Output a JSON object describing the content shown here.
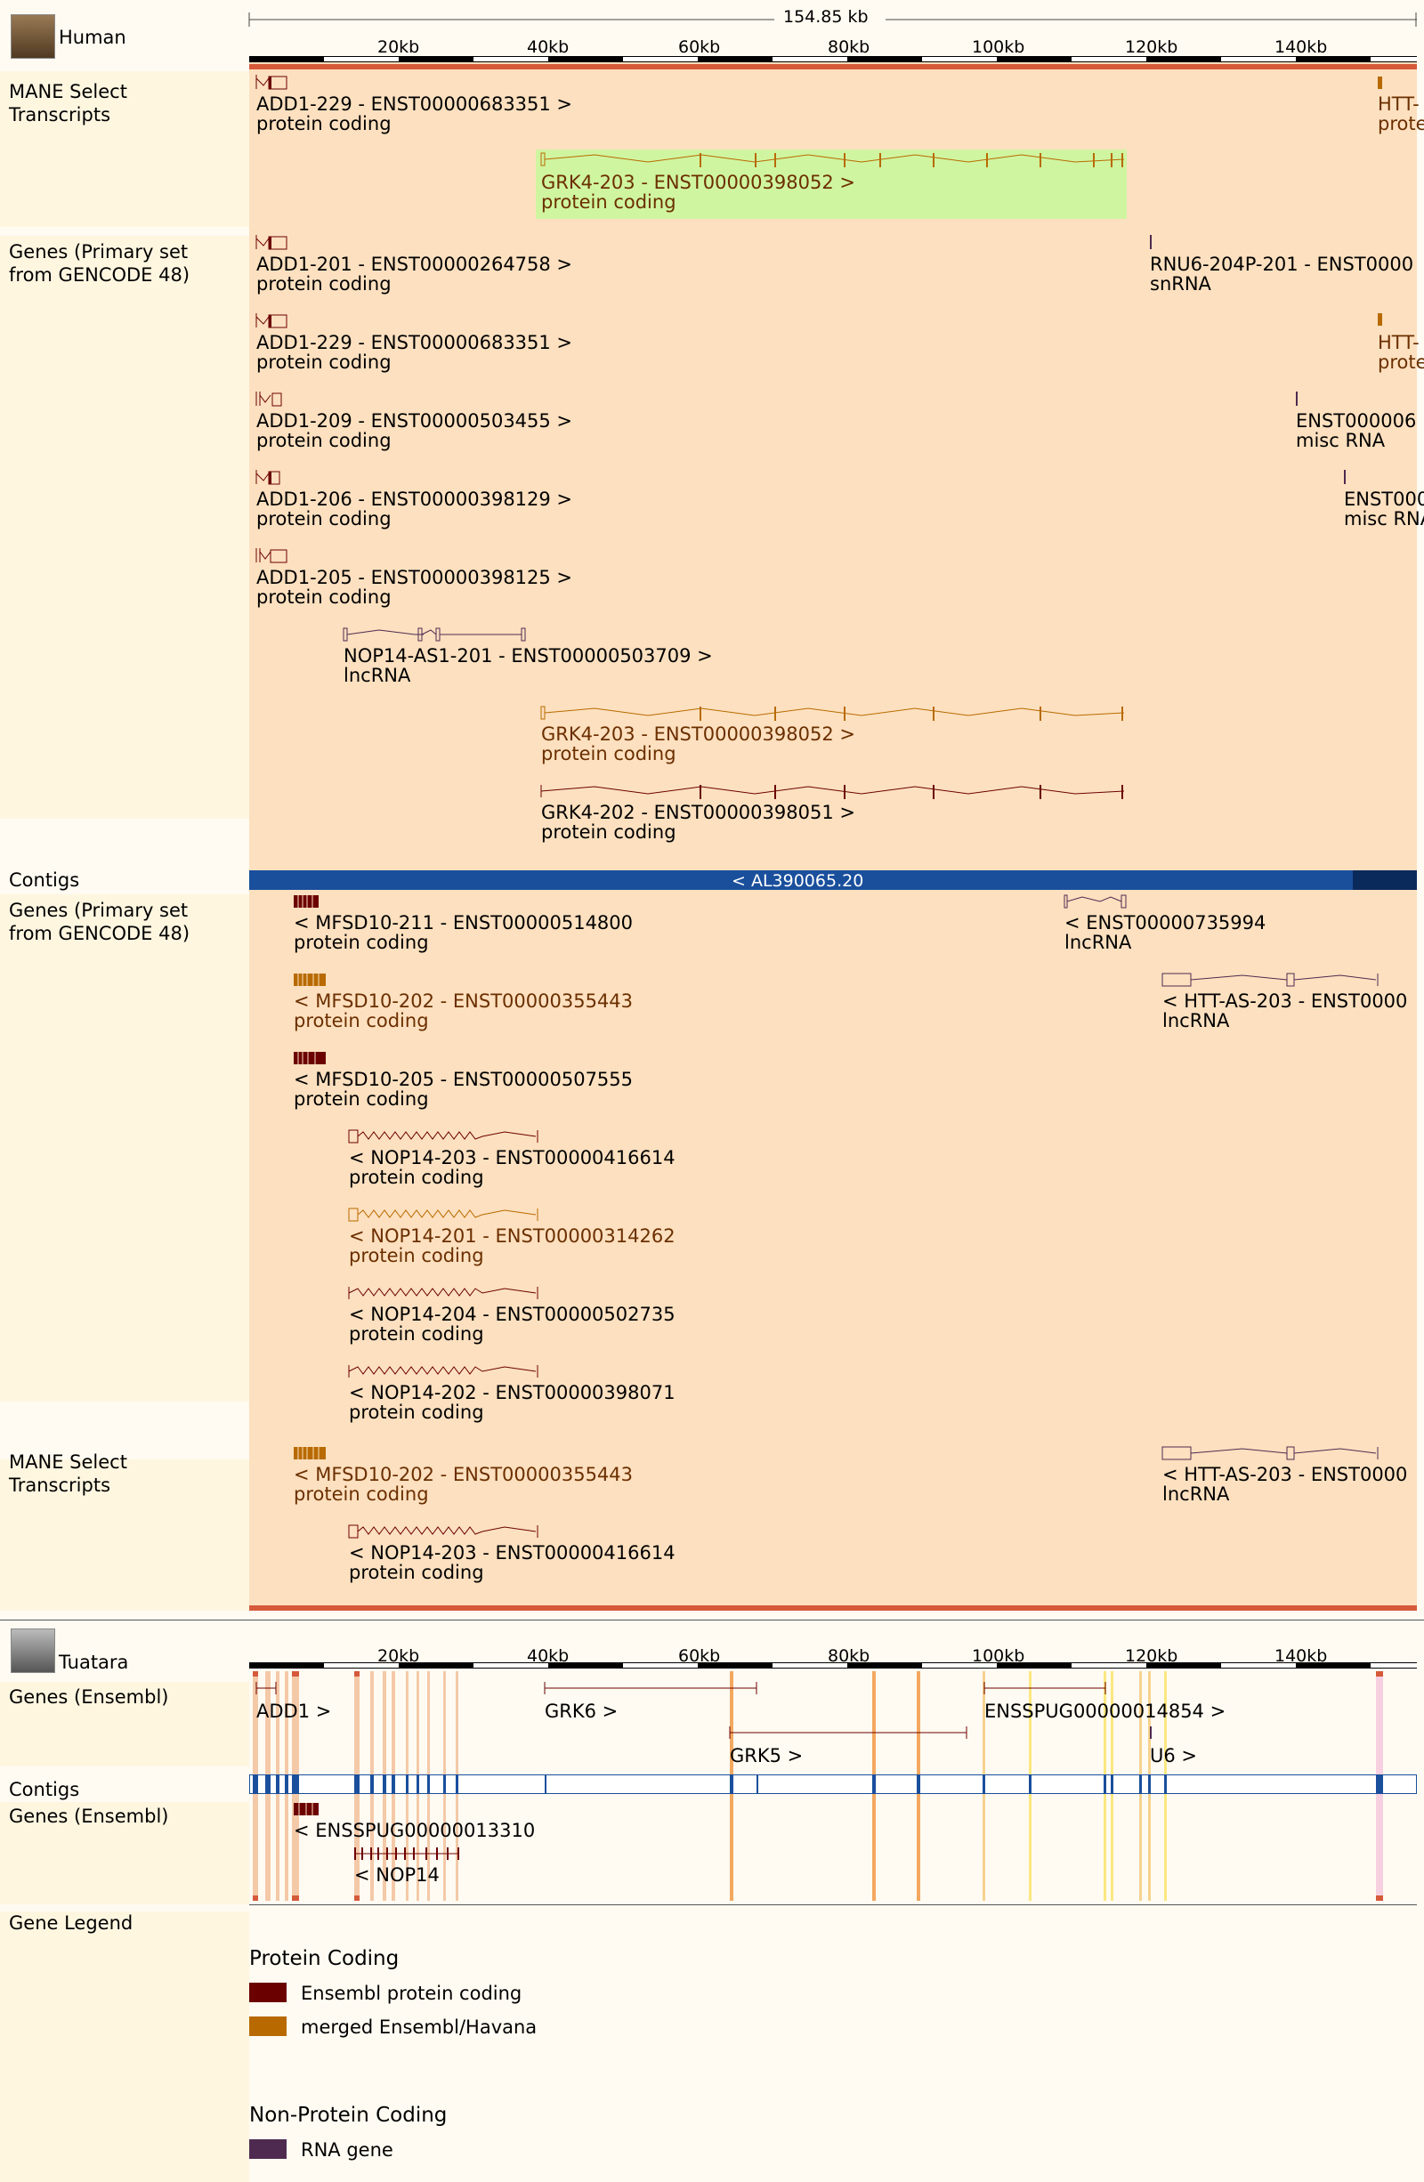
{
  "human": {
    "species": "Human",
    "scale_label": "154.85 kb",
    "ruler_ticks": [
      "20kb",
      "40kb",
      "60kb",
      "80kb",
      "100kb",
      "120kb",
      "140kb"
    ],
    "tracks": {
      "mane1": "MANE Select Transcripts",
      "genes1": "Genes (Primary set from GENCODE 48)",
      "contigs": "Contigs",
      "genes2": "Genes (Primary set from GENCODE 48)",
      "mane2": "MANE Select Transcripts"
    },
    "mane1_features": [
      {
        "id": "ADD1-229 - ENST00000683351 >",
        "type": "protein coding"
      },
      {
        "id": "HTT-",
        "type": "prote"
      },
      {
        "id": "GRK4-203 - ENST00000398052 >",
        "type": "protein coding"
      }
    ],
    "genes1_features": [
      {
        "id": "ADD1-201 - ENST00000264758 >",
        "type": "protein coding"
      },
      {
        "id": "RNU6-204P-201 - ENST0000",
        "type": "snRNA"
      },
      {
        "id": "ADD1-229 - ENST00000683351 >",
        "type": "protein coding"
      },
      {
        "id": "HTT-",
        "type": "prote"
      },
      {
        "id": "ADD1-209 - ENST00000503455 >",
        "type": "protein coding"
      },
      {
        "id": "ENST000006",
        "type": "misc RNA"
      },
      {
        "id": "ADD1-206 - ENST00000398129 >",
        "type": "protein coding"
      },
      {
        "id": "ENST000",
        "type": "misc RNA"
      },
      {
        "id": "ADD1-205 - ENST00000398125 >",
        "type": "protein coding"
      },
      {
        "id": "NOP14-AS1-201 - ENST00000503709 >",
        "type": "lncRNA"
      },
      {
        "id": "GRK4-203 - ENST00000398052 >",
        "type": "protein coding"
      },
      {
        "id": "GRK4-202 - ENST00000398051 >",
        "type": "protein coding"
      }
    ],
    "contig_label": "< AL390065.20",
    "genes2_features": [
      {
        "id": "< MFSD10-211 - ENST00000514800",
        "type": "protein coding"
      },
      {
        "id": "< ENST00000735994",
        "type": "lncRNA"
      },
      {
        "id": "< MFSD10-202 - ENST00000355443",
        "type": "protein coding"
      },
      {
        "id": "< HTT-AS-203 - ENST0000",
        "type": "lncRNA"
      },
      {
        "id": "< MFSD10-205 - ENST00000507555",
        "type": "protein coding"
      },
      {
        "id": "< NOP14-203 - ENST00000416614",
        "type": "protein coding"
      },
      {
        "id": "< NOP14-201 - ENST00000314262",
        "type": "protein coding"
      },
      {
        "id": "< NOP14-204 - ENST00000502735",
        "type": "protein coding"
      },
      {
        "id": "< NOP14-202 - ENST00000398071",
        "type": "protein coding"
      }
    ],
    "mane2_features": [
      {
        "id": "< MFSD10-202 - ENST00000355443",
        "type": "protein coding"
      },
      {
        "id": "< HTT-AS-203 - ENST0000",
        "type": "lncRNA"
      },
      {
        "id": "< NOP14-203 - ENST00000416614",
        "type": "protein coding"
      }
    ]
  },
  "tuatara": {
    "species": "Tuatara",
    "ruler_ticks": [
      "20kb",
      "40kb",
      "60kb",
      "80kb",
      "100kb",
      "120kb",
      "140kb"
    ],
    "tracks": {
      "genes1": "Genes (Ensembl)",
      "contigs": "Contigs",
      "genes2": "Genes (Ensembl)"
    },
    "genes1_features": [
      "ADD1 >",
      "GRK6 >",
      "ENSSPUG00000014854 >",
      "GRK5 >",
      "U6 >"
    ],
    "genes2_features": [
      "< ENSSPUG00000013310",
      "< NOP14"
    ]
  },
  "legend": {
    "title": "Gene Legend",
    "protein_heading": "Protein Coding",
    "protein_items": [
      {
        "label": "Ensembl protein coding",
        "color": "#6b0000"
      },
      {
        "label": "merged Ensembl/Havana",
        "color": "#b86a00"
      }
    ],
    "nonprotein_heading": "Non-Protein Coding",
    "nonprotein_items": [
      {
        "label": "RNA gene",
        "color": "#4f2a50"
      }
    ]
  },
  "colors": {
    "highlight": "#fde0bf",
    "contig_blue": "#1a4f9c",
    "red_bar": "#d55a3a",
    "green": "#d0f5a0"
  }
}
